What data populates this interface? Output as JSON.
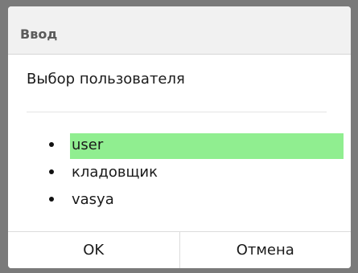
{
  "dialog": {
    "title": "Ввод",
    "message": "Выбор пользователя",
    "items": [
      {
        "label": "user",
        "selected": true
      },
      {
        "label": "кладовщик",
        "selected": false
      },
      {
        "label": "vasya",
        "selected": false
      }
    ],
    "selected_color": "#90ee90",
    "ok_label": "OK",
    "cancel_label": "Отмена"
  }
}
